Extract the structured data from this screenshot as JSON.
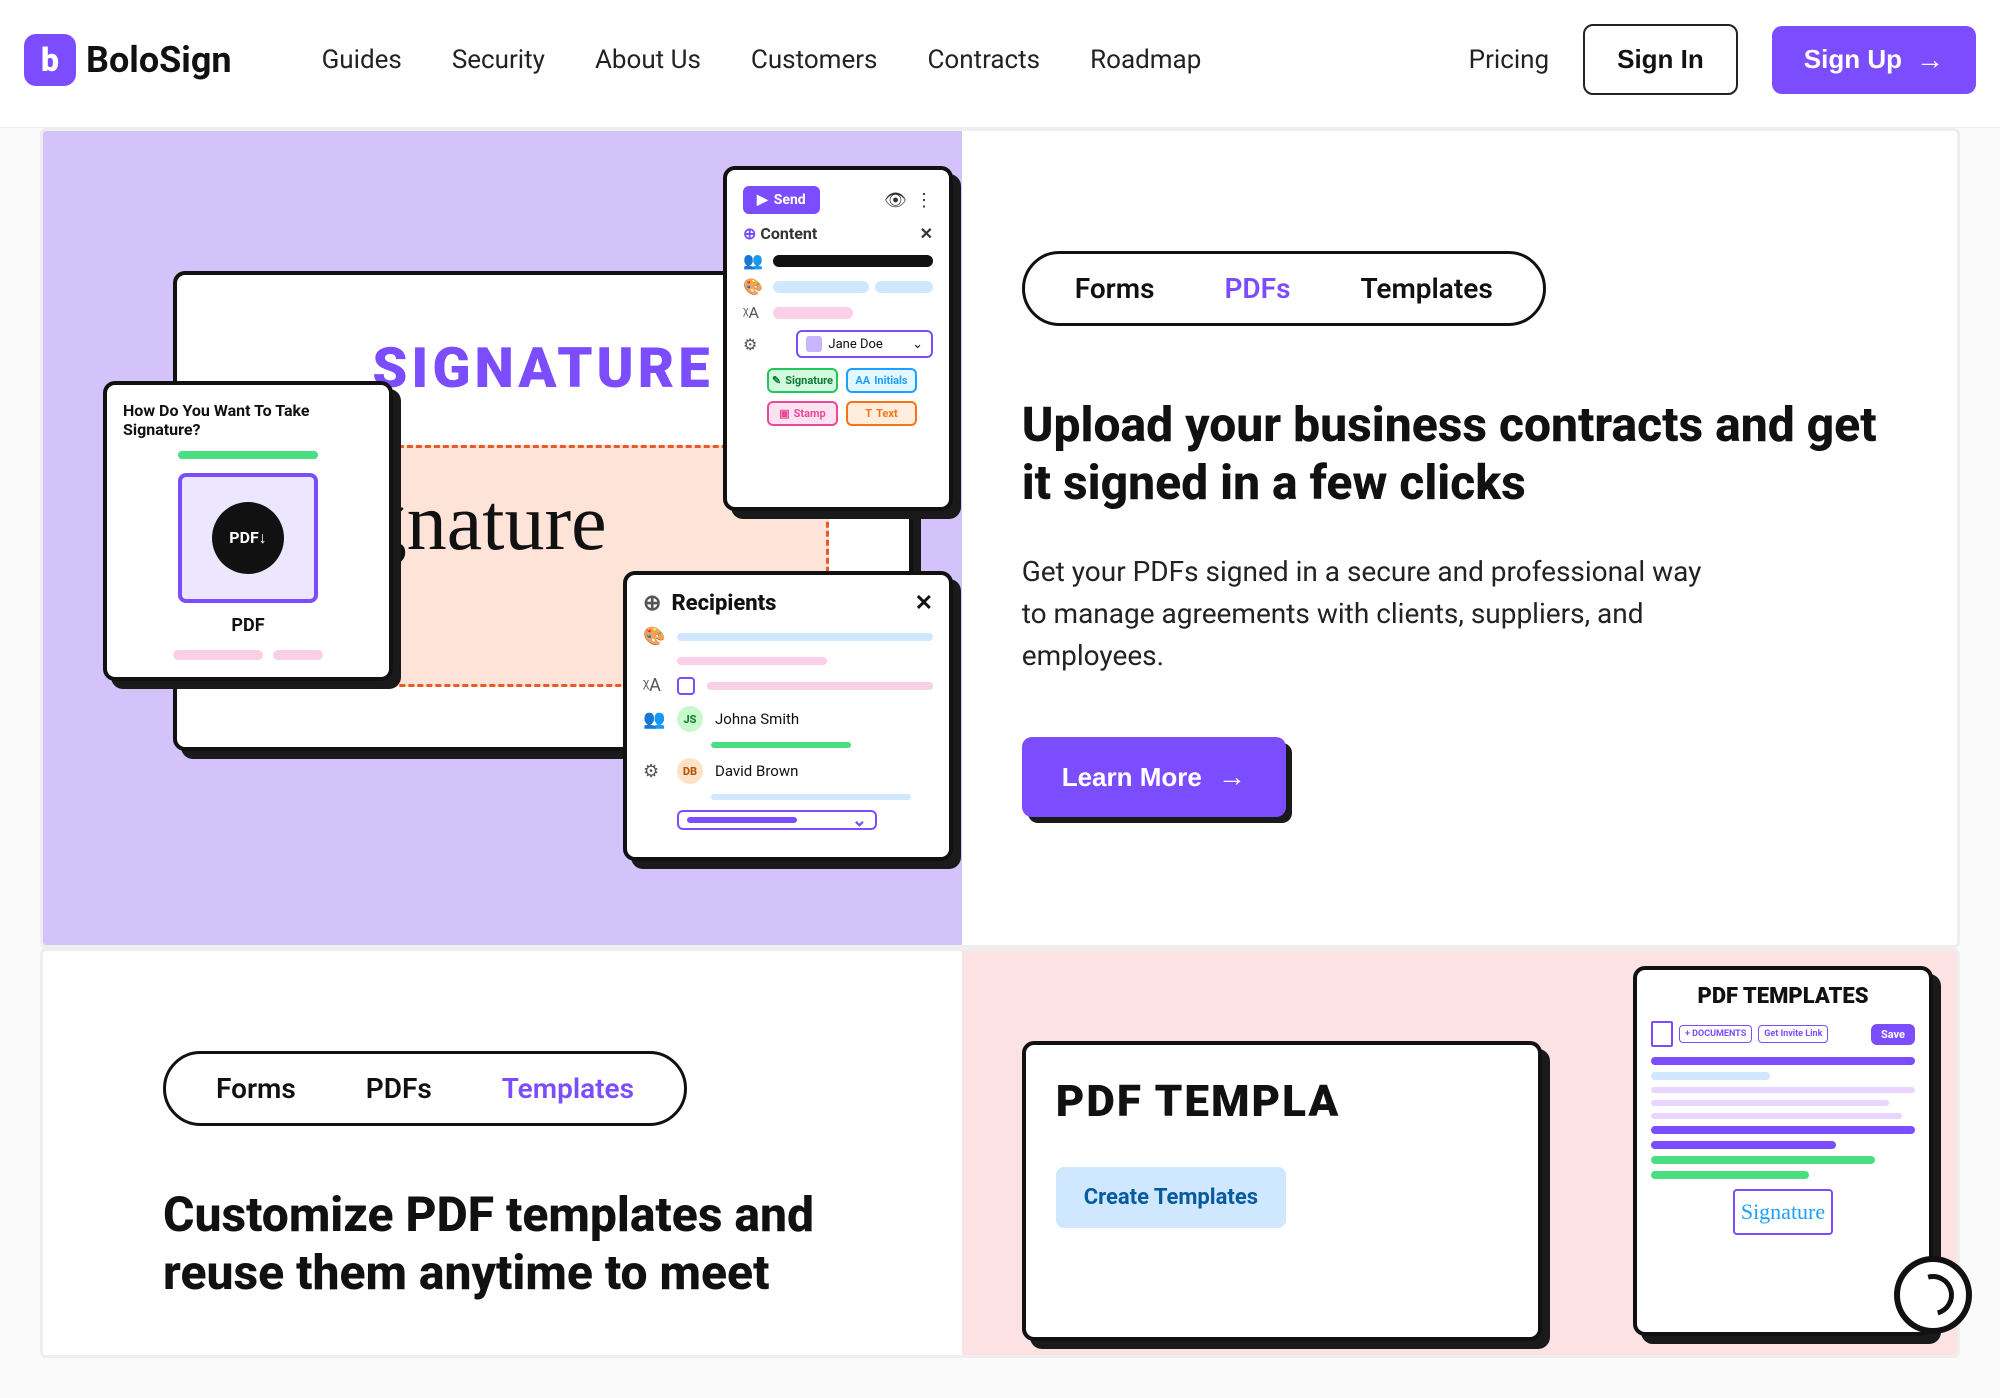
{
  "brand": "BoloSign",
  "nav": {
    "items": [
      "Guides",
      "Security",
      "About Us",
      "Customers",
      "Contracts",
      "Roadmap"
    ],
    "pricing": "Pricing",
    "signin": "Sign In",
    "signup": "Sign Up"
  },
  "section_pdfs": {
    "tabs": [
      "Forms",
      "PDFs",
      "Templates"
    ],
    "active_tab": "PDFs",
    "title": "Upload your business contracts and get it signed in a few clicks",
    "body": "Get your PDFs signed in a secure and professional way to manage agreements with clients, suppliers, and employees.",
    "cta": "Learn More",
    "illus": {
      "headline": "SIGNATURE",
      "script": "Signature",
      "card_pdf_title": "How Do You Want To Take Signature?",
      "pdf_label": "PDF",
      "content": {
        "send": "Send",
        "head": "Content",
        "select_name": "Jane Doe",
        "chips": [
          {
            "label": "Signature",
            "color": "#22c55e",
            "bg": "#d1fadf"
          },
          {
            "label": "Initials",
            "color": "#1e9fff",
            "bg": "#e3f7ff"
          },
          {
            "label": "Stamp",
            "color": "#ec4899",
            "bg": "#fde2ef"
          },
          {
            "label": "Text",
            "color": "#f97316",
            "bg": "#ffeedd"
          }
        ]
      },
      "recipients": {
        "head": "Recipients",
        "people": [
          {
            "initials": "JS",
            "name": "Johna Smith",
            "bg": "#C7F9CC",
            "color": "#188038"
          },
          {
            "initials": "DB",
            "name": "David Brown",
            "bg": "#FEE2C5",
            "color": "#B45309"
          }
        ]
      }
    }
  },
  "section_templates": {
    "tabs": [
      "Forms",
      "PDFs",
      "Templates"
    ],
    "active_tab": "Templates",
    "title": "Customize PDF templates and reuse them anytime to meet",
    "illus": {
      "card_title": "PDF TEMPLATES",
      "documents_btn": "+ DOCUMENTS",
      "invite_btn": "Get Invite Link",
      "save_btn": "Save",
      "big_title": "PDF TEMPLA",
      "create_label": "Create Templates",
      "sig_script": "Signature"
    }
  },
  "colors": {
    "primary": "#7C4DFF",
    "lilac_bg": "#D4C3FA",
    "pink_bg": "#FDE2E4"
  }
}
